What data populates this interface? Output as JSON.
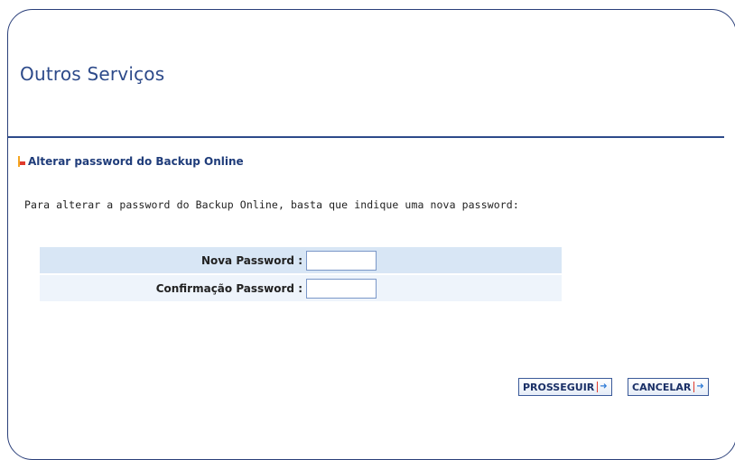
{
  "page": {
    "title": "Outros Serviços"
  },
  "section": {
    "title": "Alterar password do Backup Online",
    "intro": "Para alterar a password do Backup Online, basta que indique uma nova password:"
  },
  "form": {
    "new_password": {
      "label": "Nova Password :",
      "value": ""
    },
    "confirm_password": {
      "label": "Confirmação Password :",
      "value": ""
    }
  },
  "buttons": {
    "proceed": {
      "label": "PROSSEGUIR",
      "icon": "arrow-right-icon"
    },
    "cancel": {
      "label": "CANCELAR",
      "icon": "arrow-right-icon"
    }
  },
  "colors": {
    "title": "#2d4a8a",
    "row_a": "#d8e6f5",
    "row_b": "#eef4fb",
    "accent_orange": "#f5a623",
    "accent_red": "#e03a2c"
  }
}
